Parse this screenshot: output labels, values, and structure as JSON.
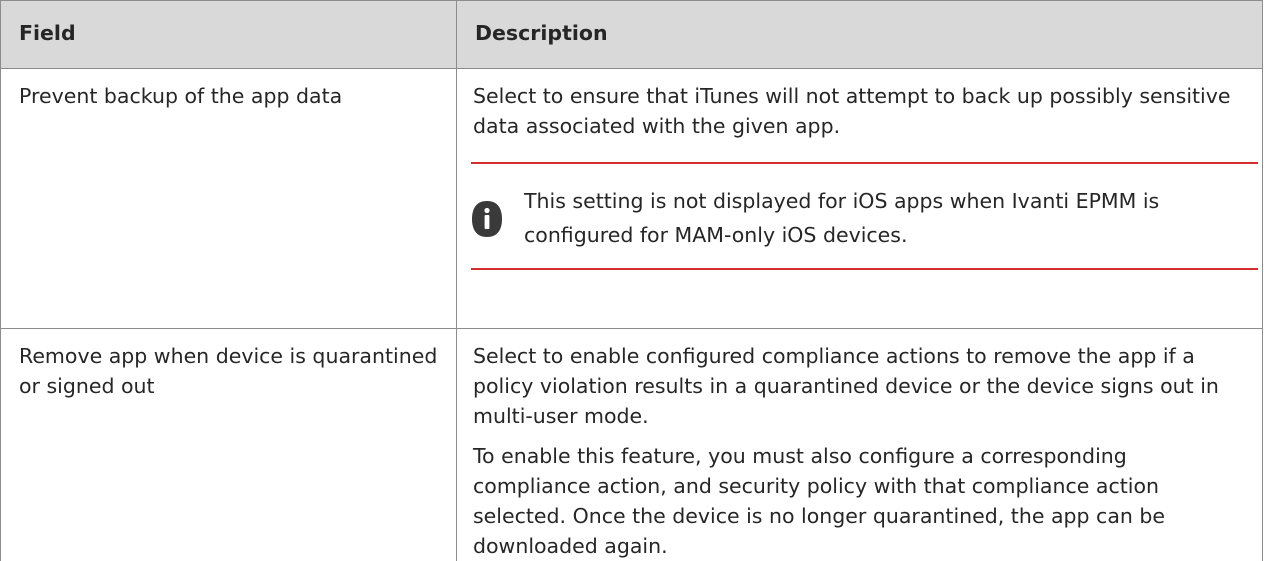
{
  "table": {
    "headers": {
      "field": "Field",
      "description": "Description"
    },
    "rows": [
      {
        "field": "Prevent backup of the app data",
        "description": "Select to ensure that iTunes will not attempt to back up possibly sensitive data associated with the given app.",
        "note": {
          "icon": "info-icon",
          "text": "This setting is not displayed for iOS apps when Ivanti EPMM is configured for MAM-only iOS devices."
        }
      },
      {
        "field": "Remove app when device is quarantined or signed out",
        "description": "Select to enable configured compliance actions to remove the app if a policy violation results in a quarantined device or the device signs out in multi-user mode.",
        "description_2": "To enable this feature, you must also configure a corresponding compliance action, and security policy with that compliance action selected. Once the device is no longer quarantined, the app can be downloaded again."
      }
    ]
  },
  "colors": {
    "header_bg": "#d9d9d9",
    "border": "#8c8c8c",
    "note_rule": "#d32f2f",
    "icon": "#3a3a3a",
    "text": "#262626"
  }
}
